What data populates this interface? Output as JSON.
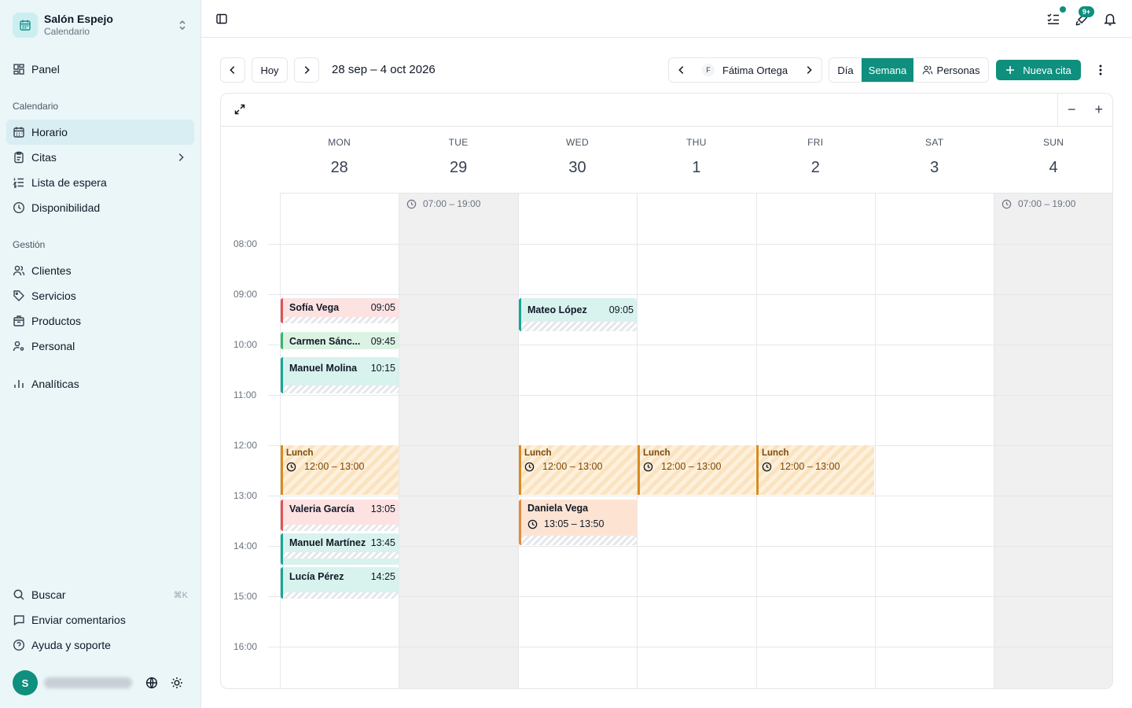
{
  "colors": {
    "accent": "#0f8f7e",
    "sidebar_bg": "#eaf6f8",
    "off_day": "#f0f0f0"
  },
  "brand": {
    "name": "Salón Espejo",
    "subtitle": "Calendario",
    "icon": "calendar-icon"
  },
  "nav": {
    "panel": "Panel",
    "section_calendar": "Calendario",
    "horario": "Horario",
    "citas": "Citas",
    "lista_espera": "Lista de espera",
    "disponibilidad": "Disponibilidad",
    "section_gestion": "Gestión",
    "clientes": "Clientes",
    "servicios": "Servicios",
    "productos": "Productos",
    "personal": "Personal",
    "analiticas": "Analíticas",
    "buscar": "Buscar",
    "buscar_shortcut": "⌘K",
    "comentarios": "Enviar comentarios",
    "ayuda": "Ayuda y soporte"
  },
  "user": {
    "initial": "S"
  },
  "topbar": {
    "notifications_count": "9+"
  },
  "toolbar": {
    "today": "Hoy",
    "range": "28 sep – 4 oct 2026",
    "staff_initial": "F",
    "staff_name": "Fátima Ortega",
    "view_day": "Día",
    "view_week": "Semana",
    "view_people": "Personas",
    "new_appointment": "Nueva cita"
  },
  "days": [
    {
      "name": "MON",
      "date": "28"
    },
    {
      "name": "TUE",
      "date": "29"
    },
    {
      "name": "WED",
      "date": "30"
    },
    {
      "name": "THU",
      "date": "1"
    },
    {
      "name": "FRI",
      "date": "2"
    },
    {
      "name": "SAT",
      "date": "3"
    },
    {
      "name": "SUN",
      "date": "4"
    }
  ],
  "time_labels": [
    "08:00",
    "09:00",
    "10:00",
    "11:00",
    "12:00",
    "13:00",
    "14:00",
    "15:00",
    "16:00"
  ],
  "availability": {
    "tue": "07:00 – 19:00",
    "sun": "07:00 – 19:00"
  },
  "appointments": {
    "sofia": {
      "name": "Sofía Vega",
      "time": "09:05"
    },
    "carmen": {
      "name": "Carmen Sánc...",
      "time": "09:45"
    },
    "manuel_molina": {
      "name": "Manuel Molina",
      "time": "10:15"
    },
    "valeria": {
      "name": "Valeria García",
      "time": "13:05"
    },
    "manuel_martinez": {
      "name": "Manuel Martínez",
      "time": "13:45"
    },
    "lucia": {
      "name": "Lucía Pérez",
      "time": "14:25"
    },
    "mateo": {
      "name": "Mateo López",
      "time": "09:05"
    },
    "daniela": {
      "name": "Daniela Vega",
      "time": "13:05 – 13:50"
    }
  },
  "lunch": {
    "label": "Lunch",
    "time": "12:00 – 13:00"
  }
}
